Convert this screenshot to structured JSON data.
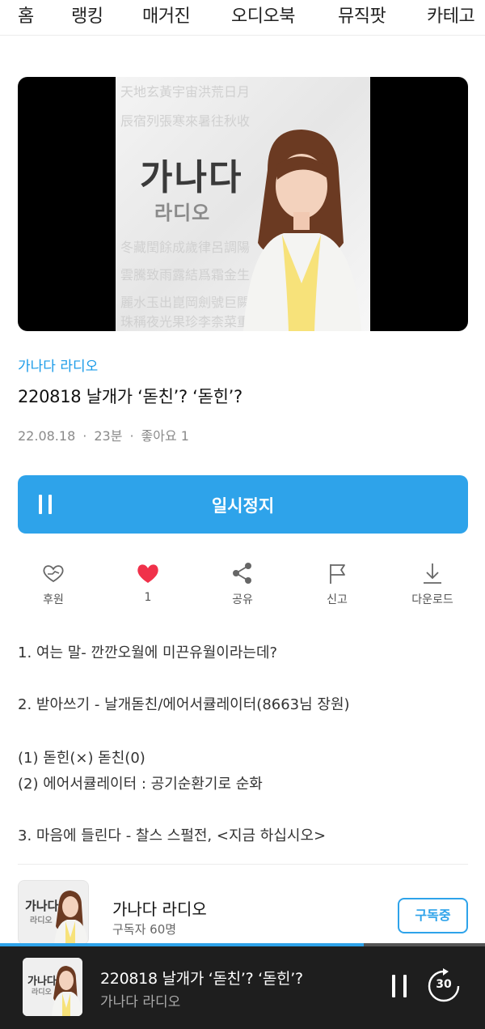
{
  "nav": {
    "items": [
      "홈",
      "랭킹",
      "매거진",
      "오디오북",
      "뮤직팟",
      "카테고"
    ]
  },
  "cover": {
    "title": "가나다",
    "subtitle": "라디오"
  },
  "episode": {
    "channel": "가나다 라디오",
    "title": "220818 날개가 ‘돋친’? ‘돋힌’?",
    "date": "22.08.18",
    "duration": "23분",
    "likes": "좋아요 1"
  },
  "pause_button": {
    "label": "일시정지"
  },
  "actions": [
    {
      "label": "후원",
      "icon": "gift-heart-icon"
    },
    {
      "label": "1",
      "icon": "heart-icon"
    },
    {
      "label": "공유",
      "icon": "share-icon"
    },
    {
      "label": "신고",
      "icon": "flag-icon"
    },
    {
      "label": "다운로드",
      "icon": "download-icon"
    }
  ],
  "description": [
    "1. 여는 말- 깐깐오월에 미끈유월이라는데?",
    "2. 받아쓰기 - 날개돋친/에어서큘레이터(8663님 장원)",
    "(1) 돋힌(×) 돋친(0)",
    "(2) 에어서큘레이터 : 공기순환기로 순화",
    "3. 마음에 들린다 - 찰스 스펄전, <지금 하십시오>"
  ],
  "channel_card": {
    "name": "가나다 라디오",
    "subscribers": "구독자 60명",
    "subscribe_label": "구독중",
    "thumb_title": "가나다",
    "thumb_subtitle": "라디오"
  },
  "mini_player": {
    "title": "220818 날개가 ‘돋친’? ‘돋힌’?",
    "channel": "가나다 라디오",
    "skip_seconds": "30",
    "progress": 0.75
  },
  "colors": {
    "accent": "#2ea3ea",
    "like": "#f0314a",
    "player_bg": "#1e1e1e"
  }
}
